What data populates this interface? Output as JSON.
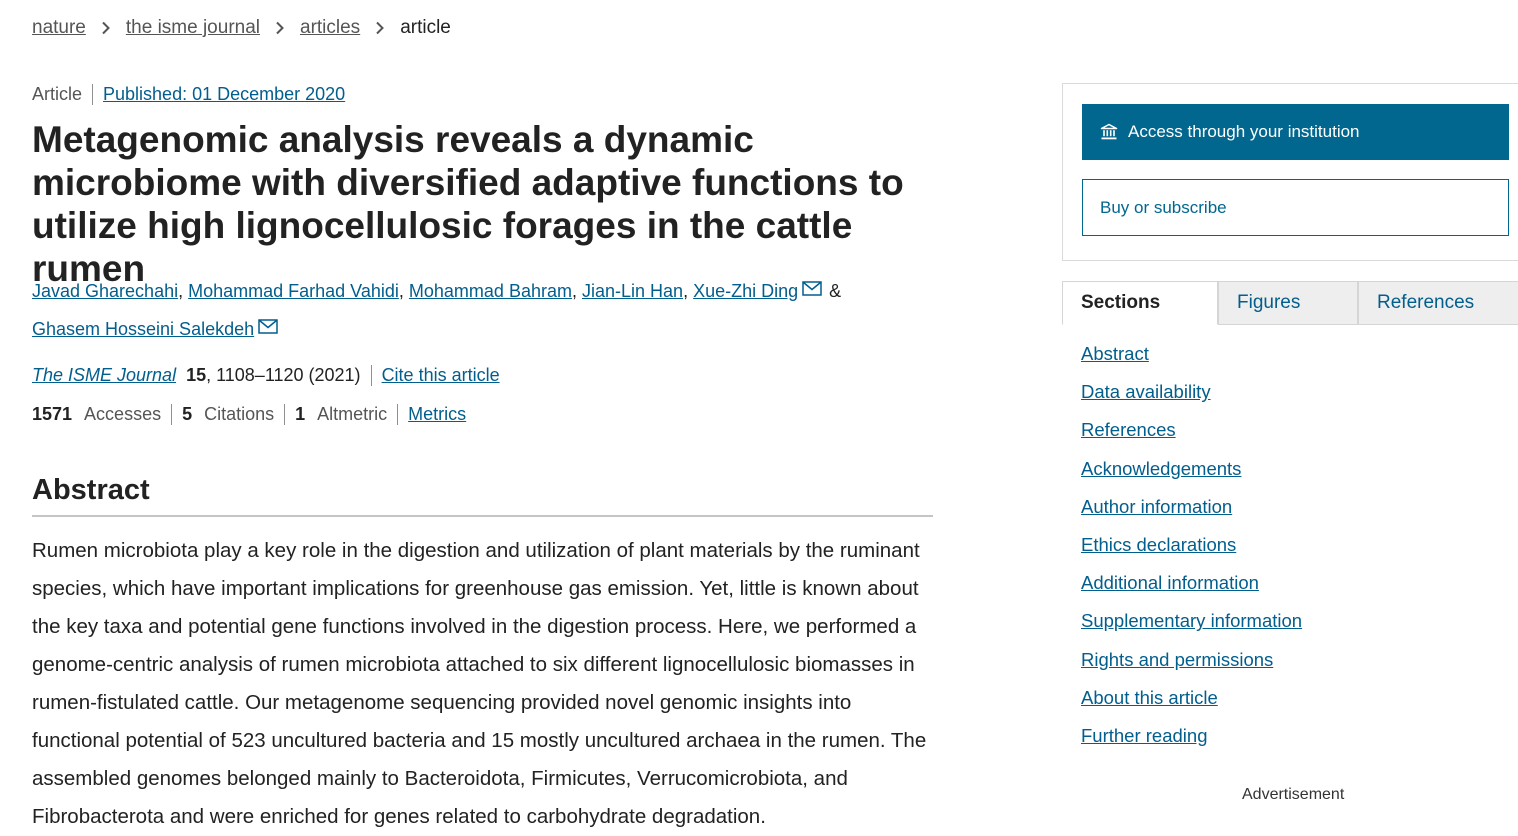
{
  "breadcrumb": {
    "items": [
      "nature",
      "the isme journal",
      "articles"
    ],
    "current": "article"
  },
  "article": {
    "type": "Article",
    "published": "Published: 01 December 2020",
    "title": "Metagenomic analysis reveals a dynamic microbiome with diversified adaptive functions to utilize high lignocellulosic forages in the cattle rumen",
    "authors": [
      "Javad Gharechahi",
      "Mohammad Farhad Vahidi",
      "Mohammad Bahram",
      "Jian-Lin Han",
      "Xue-Zhi Ding",
      "Ghasem Hosseini Salekdeh"
    ],
    "authors_ampersand": "&",
    "journal": {
      "name": "The ISME Journal",
      "volume": "15",
      "pages_year": ", 1108–1120 (2021)",
      "cite_label": "Cite this article"
    },
    "metrics": {
      "accesses_value": "1571",
      "accesses_label": "Accesses",
      "citations_value": "5",
      "citations_label": "Citations",
      "altmetric_value": "1",
      "altmetric_label": "Altmetric",
      "metrics_link": "Metrics"
    }
  },
  "abstract": {
    "heading": "Abstract",
    "text": "Rumen microbiota play a key role in the digestion and utilization of plant materials by the ruminant species, which have important implications for greenhouse gas emission. Yet, little is known about the key taxa and potential gene functions involved in the digestion process. Here, we performed a genome-centric analysis of rumen microbiota attached to six different lignocellulosic biomasses in rumen-fistulated cattle. Our metagenome sequencing provided novel genomic insights into functional potential of 523 uncultured bacteria and 15 mostly uncultured archaea in the rumen. The assembled genomes belonged mainly to Bacteroidota, Firmicutes, Verrucomicrobiota, and Fibrobacterota and were enriched for genes related to carbohydrate degradation."
  },
  "sidebar": {
    "access_button": "Access through your institution",
    "buy_button": "Buy or subscribe",
    "tabs": [
      "Sections",
      "Figures",
      "References"
    ],
    "sections": [
      "Abstract",
      "Data availability",
      "References",
      "Acknowledgements",
      "Author information",
      "Ethics declarations",
      "Additional information",
      "Supplementary information",
      "Rights and permissions",
      "About this article",
      "Further reading"
    ],
    "advertisement": "Advertisement"
  },
  "colors": {
    "link": "#025e8d",
    "primary_button": "#01678f",
    "text": "#222222"
  },
  "icons": [
    "chevron-right-icon",
    "mail-icon",
    "institution-icon"
  ]
}
